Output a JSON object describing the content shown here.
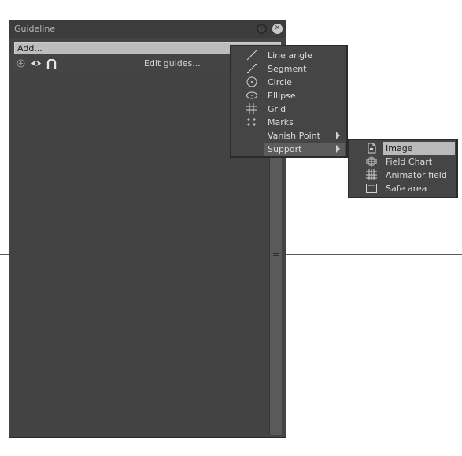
{
  "panel": {
    "title": "Guideline",
    "add_label": "Add...",
    "edit_guides_label": "Edit guides..."
  },
  "menu": {
    "items": [
      {
        "label": "Line angle",
        "icon": "line-angle-icon"
      },
      {
        "label": "Segment",
        "icon": "segment-icon"
      },
      {
        "label": "Circle",
        "icon": "circle-icon"
      },
      {
        "label": "Ellipse",
        "icon": "ellipse-icon"
      },
      {
        "label": "Grid",
        "icon": "grid-icon"
      },
      {
        "label": "Marks",
        "icon": "marks-icon"
      },
      {
        "label": "Vanish Point",
        "icon": ""
      },
      {
        "label": "Support",
        "icon": ""
      }
    ]
  },
  "submenu": {
    "items": [
      {
        "label": "Image",
        "icon": "image-doc-icon"
      },
      {
        "label": "Field Chart",
        "icon": "field-chart-icon"
      },
      {
        "label": "Animator field",
        "icon": "animator-field-icon"
      },
      {
        "label": "Safe area",
        "icon": "safe-area-icon"
      }
    ]
  },
  "colors": {
    "panel_bg": "#444444",
    "menu_bg": "#454545",
    "highlight_light": "#bababa",
    "highlight_dark": "#5c5c5c"
  }
}
